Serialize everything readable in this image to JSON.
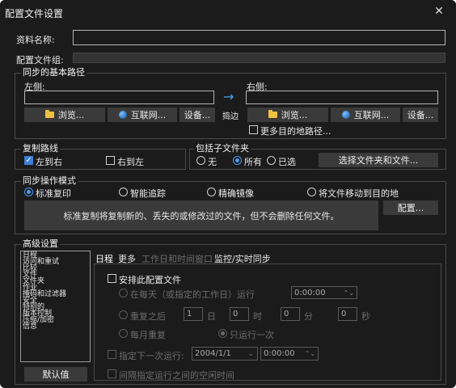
{
  "window": {
    "title": "配置文件设置",
    "close": "✕"
  },
  "profile": {
    "name_label": "资料名称:",
    "group_label": "配置文件组:"
  },
  "paths": {
    "group_title": "同步的基本路径",
    "left_label": "左侧:",
    "right_label": "右侧:",
    "browse": "浏览...",
    "internet": "互联网...",
    "settings": "设备...",
    "swap": "捣边",
    "more_dest": "更多目的地路径..."
  },
  "direction": {
    "title": "复制路线",
    "ltr": "左到右",
    "rtl": "右到左"
  },
  "subfolders": {
    "title": "包括子文件夹",
    "none": "无",
    "all": "所有",
    "selected": "已选",
    "select_btn": "选择文件夹和文件..."
  },
  "mode": {
    "title": "同步操作模式",
    "standard": "标准复印",
    "smart": "智能追踪",
    "mirror": "精确镜像",
    "move": "将文件移动到目的地",
    "description": "标准复制将复制新的、丢失的或修改过的文件，但不会删除任何文件。",
    "config_btn": "配置..."
  },
  "advanced": {
    "title": "高级设置",
    "list": [
      "日程",
      "访问和重试",
      "比较",
      "文件",
      "文件夹",
      "作业",
      "掩码和过滤器",
      "安全",
      "特别的",
      "版本控制",
      "压缩/加密",
      "信息"
    ],
    "default_btn": "默认值",
    "tabs": [
      "日程",
      "更多",
      "工作日和时间窗口",
      "监控/实时同步"
    ]
  },
  "schedule": {
    "enable": "安排此配置文件",
    "daily": "在每天（或指定的工作日）运行",
    "daily_time": "0:00:00",
    "repeat": "重复之后",
    "repeat_days": "1",
    "day_unit": "日",
    "repeat_hours": "0",
    "hour_unit": "时",
    "repeat_minutes": "0",
    "minute_unit": "分",
    "repeat_seconds": "0",
    "second_unit": "秒",
    "monthly": "每月重复",
    "once": "只运行一次",
    "next_run_label": "指定下一次运行:",
    "next_date": "2004/1/1",
    "next_time": "0:00:00",
    "interval": "间隔指定运行之间的空闲时间"
  }
}
